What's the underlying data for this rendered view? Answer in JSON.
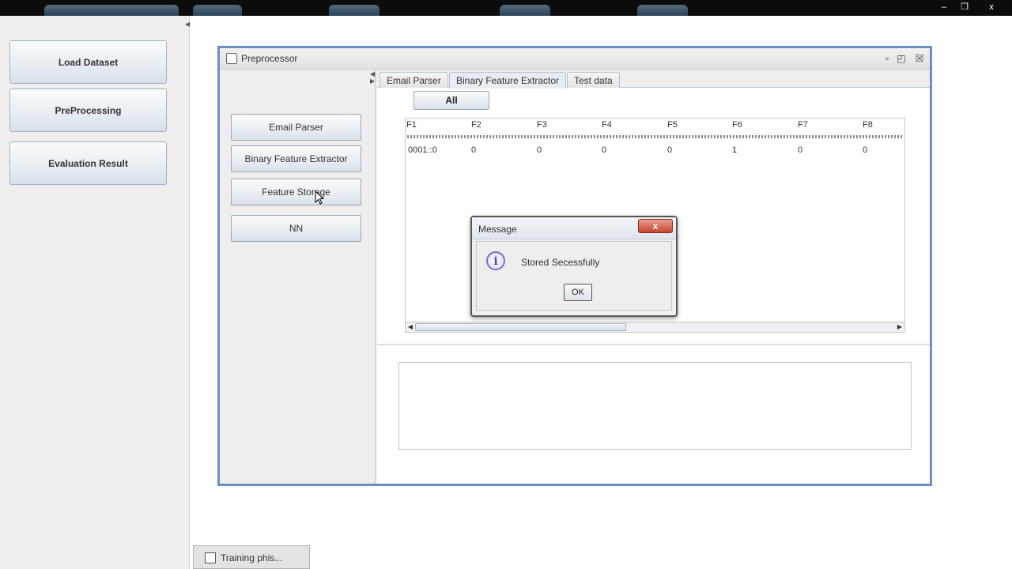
{
  "sidebar": {
    "buttons": [
      {
        "label": "Load   Dataset"
      },
      {
        "label": "PreProcessing"
      },
      {
        "label": "Evaluation Result"
      }
    ]
  },
  "frame": {
    "title": "Preprocessor",
    "left_buttons": [
      {
        "label": "Email Parser"
      },
      {
        "label": "Binary Feature Extractor"
      },
      {
        "label": "Feature Storage"
      },
      {
        "label": "NN"
      }
    ],
    "tabs": [
      {
        "label": "Email Parser"
      },
      {
        "label": "Binary Feature Extractor"
      },
      {
        "label": "Test data"
      }
    ],
    "all_button": "All",
    "table": {
      "headers": [
        "F1",
        "F2",
        "F3",
        "F4",
        "F5",
        "F6",
        "F7",
        "F8"
      ],
      "rows": [
        [
          "0001::0",
          "0",
          "0",
          "0",
          "0",
          "1",
          "0",
          "0"
        ]
      ]
    }
  },
  "dialog": {
    "title": "Message",
    "message": "Stored Secessfully",
    "ok": "OK",
    "info_glyph": "i",
    "close_glyph": "x"
  },
  "window_controls": {
    "minimize": "–",
    "maximize": "❐",
    "close": "x"
  },
  "frame_controls": {
    "iconify": "▫",
    "maximize": "◰",
    "close": "☒"
  },
  "minimized": {
    "label": "Training phis..."
  }
}
